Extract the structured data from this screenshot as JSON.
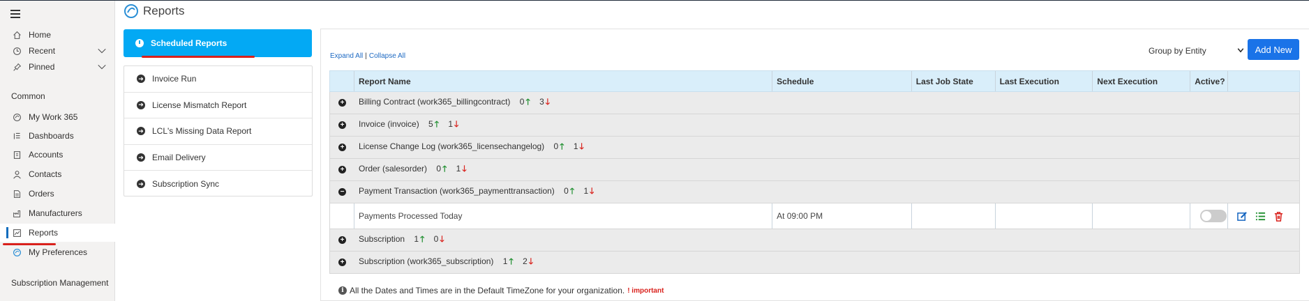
{
  "sidebar": {
    "items": [
      {
        "label": "Home",
        "icon": "home-icon"
      },
      {
        "label": "Recent",
        "icon": "clock-icon"
      },
      {
        "label": "Pinned",
        "icon": "pin-icon"
      }
    ],
    "section_common": "Common",
    "common_items": [
      {
        "label": "My Work 365",
        "icon": "work365-icon"
      },
      {
        "label": "Dashboards",
        "icon": "dashboard-icon"
      },
      {
        "label": "Accounts",
        "icon": "accounts-icon"
      },
      {
        "label": "Contacts",
        "icon": "contacts-icon"
      },
      {
        "label": "Orders",
        "icon": "orders-icon"
      },
      {
        "label": "Manufacturers",
        "icon": "manufacturers-icon"
      },
      {
        "label": "Reports",
        "icon": "reports-icon"
      },
      {
        "label": "My Preferences",
        "icon": "preferences-icon"
      }
    ],
    "section_subscription": "Subscription Management"
  },
  "header": {
    "title": "Reports"
  },
  "reports_nav": {
    "active": "Scheduled Reports",
    "items": [
      "Invoice Run",
      "License Mismatch Report",
      "LCL's Missing Data Report",
      "Email Delivery",
      "Subscription Sync"
    ]
  },
  "toolbar": {
    "expand_all": "Expand All",
    "collapse_all": "Collapse All",
    "group_by": "Group by Entity",
    "add_new": "Add New"
  },
  "table": {
    "columns": [
      "Report Name",
      "Schedule",
      "Last Job State",
      "Last Execution",
      "Next Execution",
      "Active?"
    ],
    "groups": [
      {
        "name": "Billing Contract (work365_billingcontract)",
        "up": "0",
        "down": "3"
      },
      {
        "name": "Invoice (invoice)",
        "up": "5",
        "down": "1"
      },
      {
        "name": "License Change Log (work365_licensechangelog)",
        "up": "0",
        "down": "1"
      },
      {
        "name": "Order (salesorder)",
        "up": "0",
        "down": "1"
      },
      {
        "name": "Payment Transaction (work365_paymenttransaction)",
        "up": "0",
        "down": "1"
      },
      {
        "name": "Subscription",
        "up": "1",
        "down": "0"
      },
      {
        "name": "Subscription (work365_subscription)",
        "up": "1",
        "down": "2"
      }
    ],
    "row": {
      "name": "Payments Processed Today",
      "schedule": "At 09:00 PM",
      "last_job_state": "",
      "last_execution": "",
      "next_execution": ""
    }
  },
  "footer": {
    "note": "All the Dates and Times are in the Default TimeZone for your organization.",
    "important": "! important"
  },
  "colors": {
    "accent": "#03a9f4",
    "primary_button": "#1a73e8",
    "up": "#1f8f2f",
    "down": "#d9211c",
    "header_bg": "#d9eefa"
  }
}
